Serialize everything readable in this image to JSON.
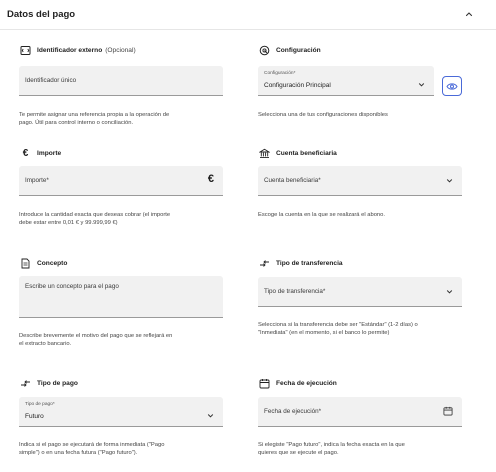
{
  "header": {
    "title": "Datos del pago"
  },
  "identificador": {
    "label": "Identificador externo",
    "optional": "(Opcional)",
    "placeholder": "Identificador único",
    "help_line1": "Te permite asignar una referencia propia a la operación de",
    "help_line2": "pago. Útil para control interno o conciliación."
  },
  "configuracion": {
    "label": "Configuración",
    "float_label": "Configuración*",
    "value": "Configuración Principal",
    "help": "Selecciona una de tus configuraciones disponibles"
  },
  "importe": {
    "label": "Importe",
    "placeholder": "Importe*",
    "currency_symbol": "€",
    "help_line1": "Introduce la cantidad exacta que deseas cobrar (el importe",
    "help_line2": "debe estar entre 0,01 € y 99.999,99 €)"
  },
  "cuenta": {
    "label": "Cuenta beneficiaria",
    "placeholder": "Cuenta beneficiaria*",
    "help": "Escoge la cuenta en la que se realizará el abono."
  },
  "concepto": {
    "label": "Concepto",
    "placeholder": "Escribe un concepto para el pago",
    "help_line1": "Describe brevemente el motivo del pago que se reflejará en",
    "help_line2": "el extracto bancario."
  },
  "tipo_transferencia": {
    "label": "Tipo de transferencia",
    "placeholder": "Tipo de transferencia*",
    "help_line1": "Selecciona si la transferencia debe ser \"Estándar\" (1-2 días) o",
    "help_line2": "\"Inmediata\" (en el momento, si el banco lo permite)"
  },
  "tipo_pago": {
    "label": "Tipo de pago",
    "float_label": "Tipo de pago*",
    "value": "Futuro",
    "help_line1": "Indica si el pago se ejecutará de forma inmediata (\"Pago",
    "help_line2": "simple\") o en una fecha futura (\"Pago futuro\")."
  },
  "fecha": {
    "label": "Fecha de ejecución",
    "placeholder": "Fecha de ejecución*",
    "help_line1": "Si elegiste \"Pago futuro\", indica la fecha exacta en la que",
    "help_line2": "quieres que se ejecute el pago."
  },
  "icons": [
    "id-card-icon",
    "settings-icon",
    "euro-icon",
    "bank-icon",
    "document-icon",
    "transfer-icon",
    "calendar-icon",
    "chevron-down-icon",
    "chevron-up-icon",
    "eye-icon"
  ],
  "colors": {
    "field_bg": "#f1f1f1",
    "accent": "#4a6ad8",
    "text": "#1f1f1f"
  }
}
